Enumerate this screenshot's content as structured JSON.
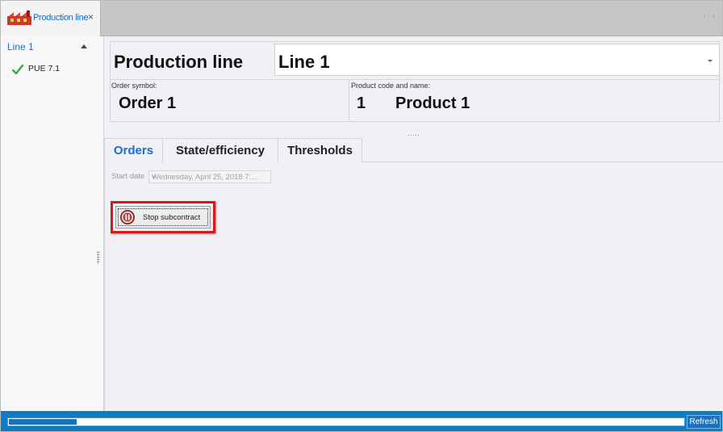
{
  "tab": {
    "title": "Production line",
    "close": "×",
    "nav_left": "‹",
    "nav_right": "›",
    "logo_icon": "factory-icon"
  },
  "sidebar": {
    "group": {
      "label": "Line 1",
      "caret_icon": "caret-up-icon"
    },
    "items": [
      {
        "label": "PUE 7.1",
        "icon": "checkmark-icon",
        "icon_color": "#3aa83a"
      }
    ]
  },
  "header": {
    "production_label": "Production line",
    "line_value": "Line 1",
    "order": {
      "caption": "Order symbol:",
      "value": "Order 1"
    },
    "product": {
      "caption": "Product code and name:",
      "code": "1",
      "name": "Product 1"
    }
  },
  "tabs": [
    {
      "label": "Orders",
      "active": true
    },
    {
      "label": "State/efficiency",
      "active": false
    },
    {
      "label": "Thresholds",
      "active": false
    }
  ],
  "orders": {
    "start_date_label": "Start date",
    "start_date_value": "Wednesday, April 25, 2018 7:...",
    "stop_button_label": "Stop subcontract",
    "stop_button_icon": "pause-icon",
    "highlight_color": "#d11c1c"
  },
  "status": {
    "progress": 0.1,
    "refresh_label": "Refresh",
    "accent": "#0f7bc8"
  }
}
